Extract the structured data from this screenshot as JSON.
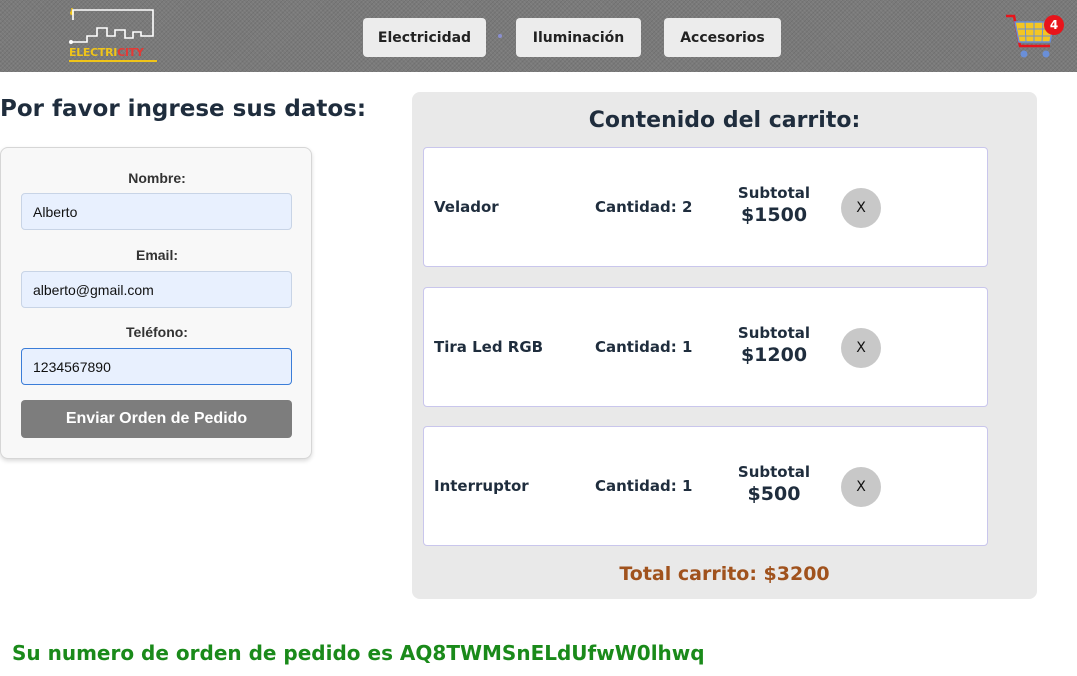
{
  "brand": {
    "logo_part1": "ELECTRI",
    "logo_part2": "CITY"
  },
  "nav": {
    "items": [
      {
        "label": "Electricidad"
      },
      {
        "label": "Iluminación"
      },
      {
        "label": "Accesorios"
      }
    ]
  },
  "cart_widget": {
    "count": "4"
  },
  "form": {
    "title": "Por favor ingrese sus datos:",
    "fields": {
      "name": {
        "label": "Nombre:",
        "value": "Alberto"
      },
      "email": {
        "label": "Email:",
        "value": "alberto@gmail.com"
      },
      "phone": {
        "label": "Teléfono:",
        "value": "1234567890"
      }
    },
    "submit_label": "Enviar Orden de Pedido"
  },
  "cart": {
    "title": "Contenido del carrito:",
    "items": [
      {
        "name": "Velador",
        "quantity": "Cantidad: 2",
        "subtotal_label": "Subtotal",
        "subtotal": "$1500",
        "remove_label": "X"
      },
      {
        "name": "Tira Led RGB",
        "quantity": "Cantidad: 1",
        "subtotal_label": "Subtotal",
        "subtotal": "$1200",
        "remove_label": "X"
      },
      {
        "name": "Interruptor",
        "quantity": "Cantidad: 1",
        "subtotal_label": "Subtotal",
        "subtotal": "$500",
        "remove_label": "X"
      }
    ],
    "total": "Total carrito: $3200"
  },
  "order_message": "Su numero de orden de pedido es AQ8TWMSnELdUfwW0lhwq",
  "colors": {
    "navbar": "#7a7a7a",
    "total_text": "#a0521d",
    "order_message": "#1a8a1a",
    "badge": "#e8141b",
    "logo_yellow": "#f0c419",
    "logo_red": "#e53935"
  }
}
